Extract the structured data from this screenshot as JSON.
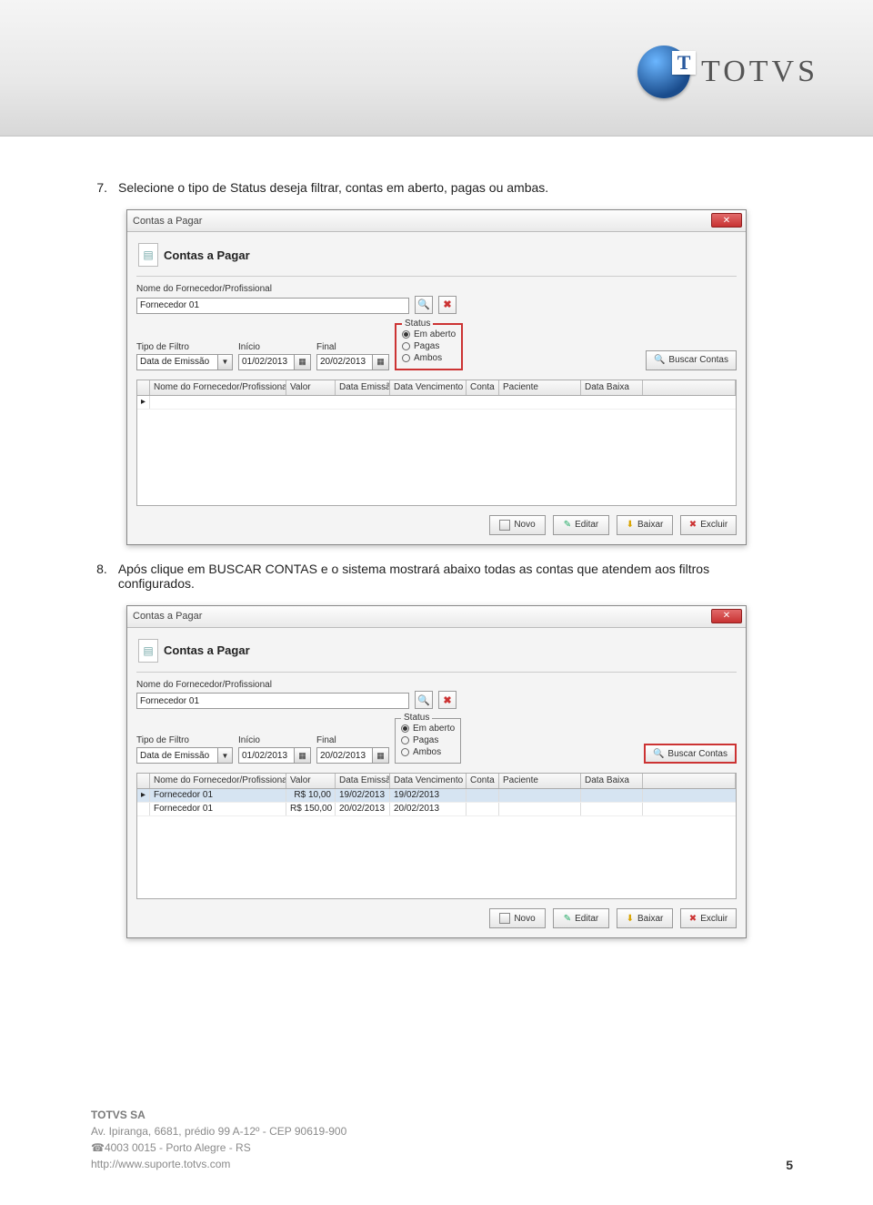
{
  "logo_text": "TOTVS",
  "steps": {
    "s7_num": "7.",
    "s7_text": "Selecione o tipo de Status deseja filtrar, contas em aberto, pagas ou ambas.",
    "s8_num": "8.",
    "s8_text": "Após clique em BUSCAR CONTAS e o sistema mostrará abaixo todas as contas que atendem aos filtros configurados."
  },
  "win": {
    "title": "Contas a Pagar",
    "panel_title": "Contas a Pagar",
    "close_x": "✕",
    "labels": {
      "fornecedor": "Nome do Fornecedor/Profissional",
      "tipo_filtro": "Tipo de Filtro",
      "inicio": "Início",
      "final": "Final",
      "status_legend": "Status"
    },
    "values": {
      "fornecedor": "Fornecedor 01",
      "tipo_filtro": "Data de Emissão",
      "inicio": "01/02/2013",
      "final": "20/02/2013"
    },
    "status_options": {
      "em_aberto": "Em aberto",
      "pagas": "Pagas",
      "ambos": "Ambos"
    },
    "buscar_label": "Buscar Contas",
    "table_headers": {
      "nome": "Nome do Fornecedor/Profissional",
      "valor": "Valor",
      "demi": "Data Emissão",
      "dven": "Data Vencimento",
      "conta": "Conta",
      "paciente": "Paciente",
      "dbaixa": "Data Baixa"
    },
    "buttons": {
      "novo": "Novo",
      "editar": "Editar",
      "baixar": "Baixar",
      "excluir": "Excluir"
    },
    "rows2": [
      {
        "nome": "Fornecedor 01",
        "valor": "R$ 10,00",
        "demi": "19/02/2013",
        "dven": "19/02/2013",
        "conta": "",
        "paciente": "",
        "dbaixa": ""
      },
      {
        "nome": "Fornecedor 01",
        "valor": "R$ 150,00",
        "demi": "20/02/2013",
        "dven": "20/02/2013",
        "conta": "",
        "paciente": "",
        "dbaixa": ""
      }
    ]
  },
  "footer": {
    "company": "TOTVS SA",
    "addr": "Av. Ipiranga, 6681, prédio 99 A-12º - CEP 90619-900",
    "phone_icon": "☎",
    "phone_line": "4003 0015 - Porto Alegre - RS",
    "url": "http://www.suporte.totvs.com"
  },
  "page_number": "5"
}
